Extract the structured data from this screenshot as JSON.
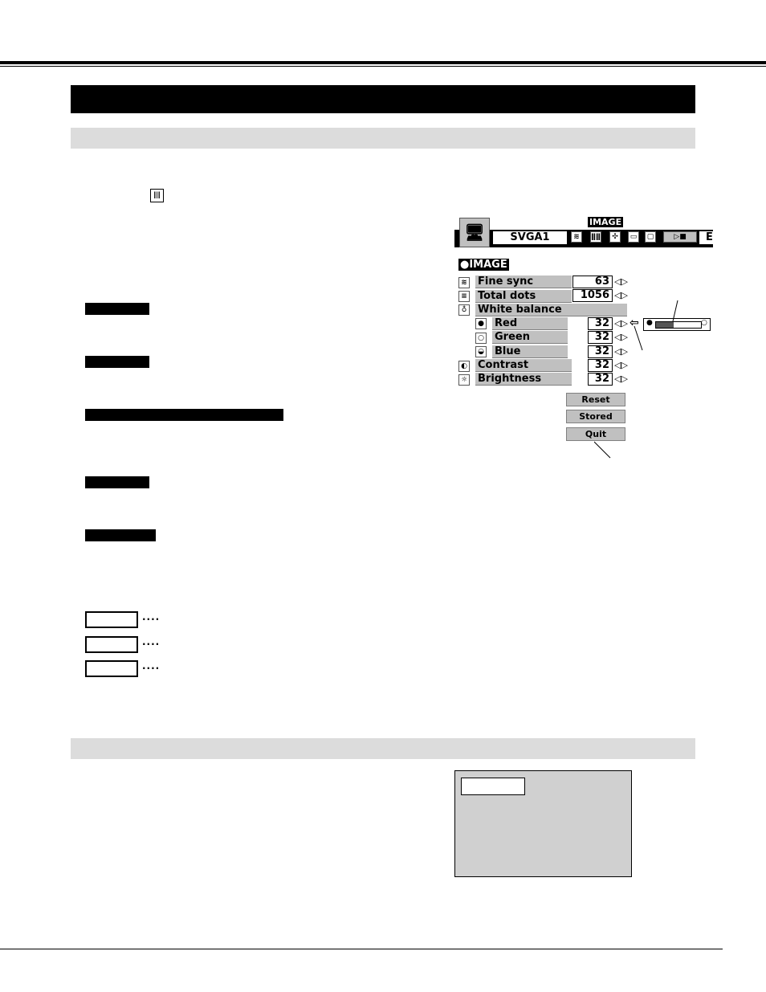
{
  "osd": {
    "toolbar_title": "IMAGE",
    "source": "SVGA1",
    "toolbar_trailing": "E",
    "menu_title": "IMAGE",
    "items": [
      {
        "label": "Fine sync",
        "value": "63",
        "icon": "fine-sync-icon"
      },
      {
        "label": "Total dots",
        "value": "1056",
        "icon": "total-dots-icon"
      },
      {
        "label": "White balance",
        "icon": "white-balance-icon"
      },
      {
        "label": "Red",
        "value": "32",
        "icon": "red-icon"
      },
      {
        "label": "Green",
        "value": "32",
        "icon": "green-icon"
      },
      {
        "label": "Blue",
        "value": "32",
        "icon": "blue-icon"
      },
      {
        "label": "Contrast",
        "value": "32",
        "icon": "contrast-icon"
      },
      {
        "label": "Brightness",
        "value": "32",
        "icon": "brightness-icon"
      }
    ],
    "buttons": {
      "reset": "Reset",
      "stored": "Stored",
      "quit": "Quit"
    },
    "slider_level": 0.4
  },
  "legend_dots": "····"
}
